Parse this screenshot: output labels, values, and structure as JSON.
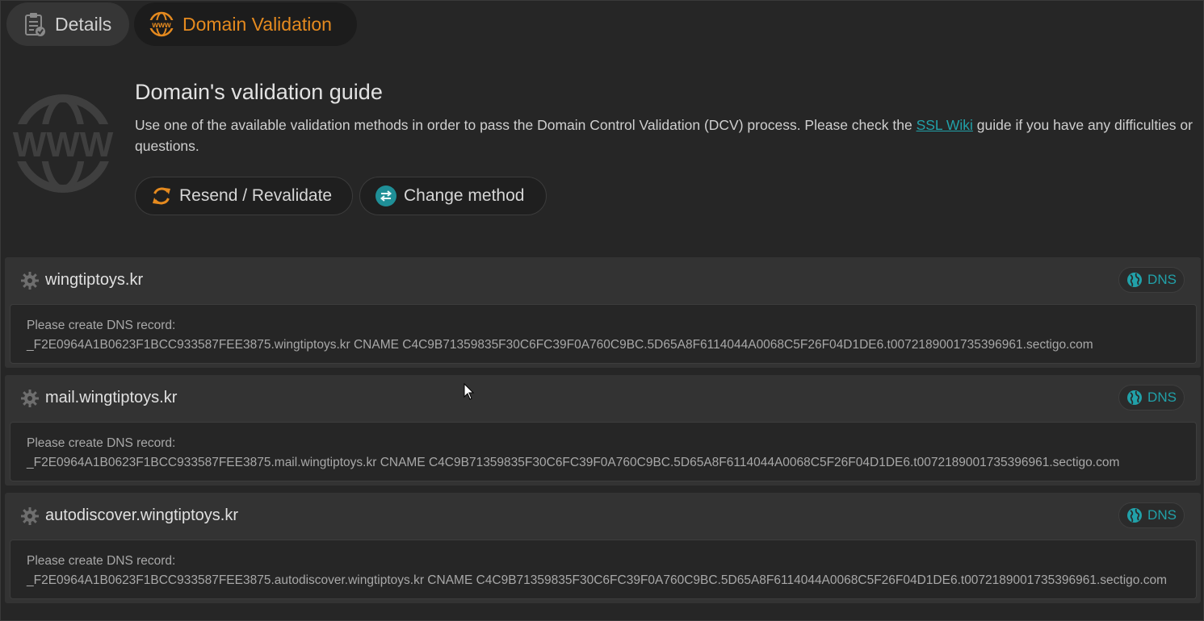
{
  "tabs": [
    {
      "label": "Details",
      "icon": "clipboard-check-icon"
    },
    {
      "label": "Domain Validation",
      "icon": "www-globe-icon",
      "active": true
    }
  ],
  "guide": {
    "title": "Domain's validation guide",
    "text_before": "Use one of the available validation methods in order to pass the Domain Control Validation (DCV) process. Please check the ",
    "link": "SSL Wiki",
    "text_after": " guide if you have any difficulties or questions.",
    "resend_label": "Resend / Revalidate",
    "change_label": "Change method"
  },
  "domains": [
    {
      "name": "wingtiptoys.kr",
      "method": "DNS",
      "instruction": "Please create DNS record:",
      "record": "_F2E0964A1B0623F1BCC933587FEE3875.wingtiptoys.kr CNAME C4C9B71359835F30C6FC39F0A760C9BC.5D65A8F6114044A0068C5F26F04D1DE6.t0072189001735396961.sectigo.com"
    },
    {
      "name": "mail.wingtiptoys.kr",
      "method": "DNS",
      "instruction": "Please create DNS record:",
      "record": "_F2E0964A1B0623F1BCC933587FEE3875.mail.wingtiptoys.kr CNAME C4C9B71359835F30C6FC39F0A760C9BC.5D65A8F6114044A0068C5F26F04D1DE6.t0072189001735396961.sectigo.com"
    },
    {
      "name": "autodiscover.wingtiptoys.kr",
      "method": "DNS",
      "instruction": "Please create DNS record:",
      "record": "_F2E0964A1B0623F1BCC933587FEE3875.autodiscover.wingtiptoys.kr CNAME C4C9B71359835F30C6FC39F0A760C9BC.5D65A8F6114044A0068C5F26F04D1DE6.t0072189001735396961.sectigo.com"
    }
  ],
  "colors": {
    "accent_orange": "#e58a1f",
    "accent_teal": "#21a1a9",
    "background": "#262626",
    "card": "#333333"
  }
}
